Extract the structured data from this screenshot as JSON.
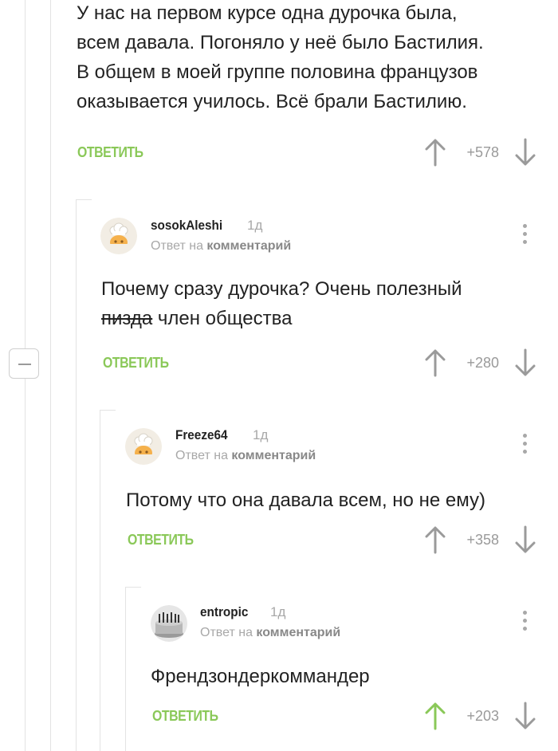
{
  "comments": [
    {
      "text_lines": [
        "У нас на первом курсе одна дурочка была,",
        "всем давала. Погоняло у неё было Бастилия.",
        "В общем в моей группе половина французов",
        "оказывается училось. Всё брали Бастилию."
      ],
      "reply_label": "ОТВЕТИТЬ",
      "rating": "+578"
    },
    {
      "username": "sosokAleshi",
      "time": "1д",
      "reply_to_prefix": "Ответ на",
      "reply_to_link": "комментарий",
      "text_line1": "Почему сразу дурочка? Очень полезный",
      "text_strike": "пизда",
      "text_line2_rest": " член общества",
      "reply_label": "ОТВЕТИТЬ",
      "rating": "+280"
    },
    {
      "username": "Freeze64",
      "time": "1д",
      "reply_to_prefix": "Ответ на",
      "reply_to_link": "комментарий",
      "text": "Потому что она давала всем, но не ему)",
      "reply_label": "ОТВЕТИТЬ",
      "rating": "+358"
    },
    {
      "username": "entropic",
      "time": "1д",
      "reply_to_prefix": "Ответ на",
      "reply_to_link": "комментарий",
      "text": "Френдзондеркоммандер",
      "reply_label": "ОТВЕТИТЬ",
      "rating": "+203",
      "upvoted": true
    }
  ],
  "icons": {
    "vote_up": "arrow-up-icon",
    "vote_down": "arrow-down-icon",
    "more": "more-vertical-icon",
    "collapse": "minus-icon",
    "avatar_default": "chef-hat-avatar",
    "avatar_custom": "cake-avatar"
  },
  "colors": {
    "accent_green": "#8ac858",
    "vote_gray": "#9a9a9a",
    "text": "#222222",
    "meta_gray": "#a8a8a8",
    "thread_line": "#e3e3e3",
    "avatar_orange": "#f5b14c"
  }
}
